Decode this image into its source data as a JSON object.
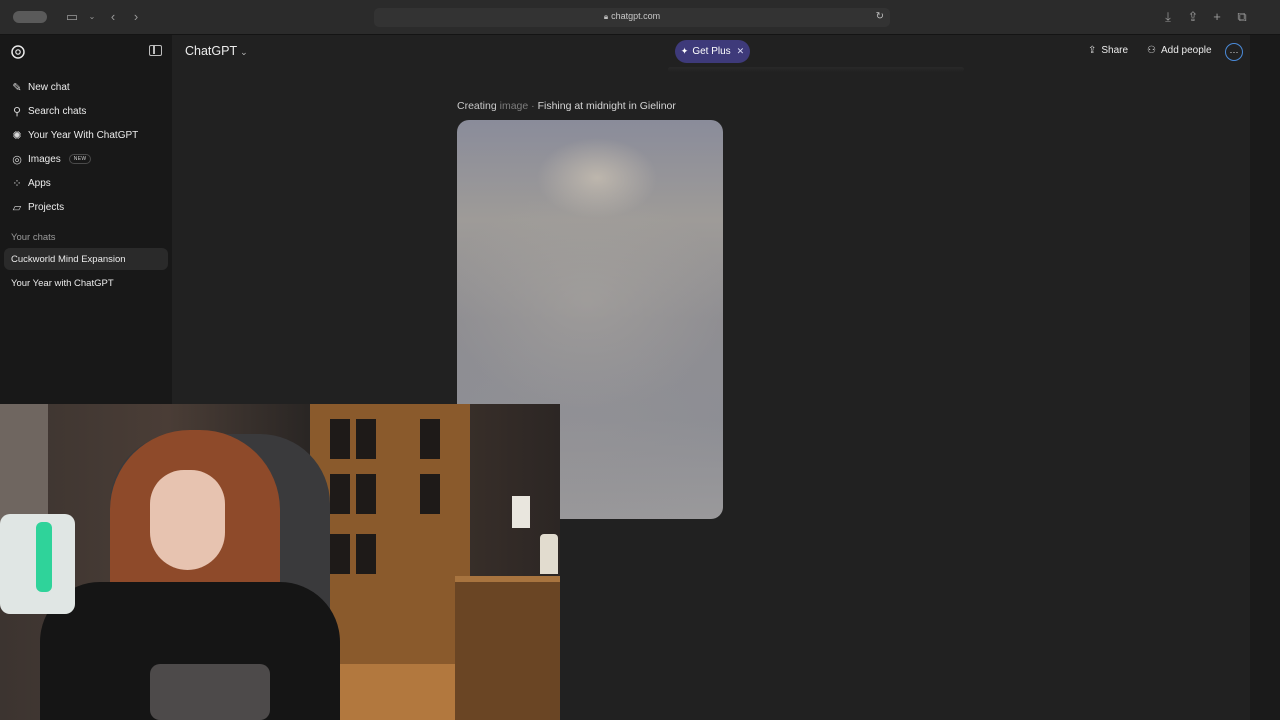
{
  "browser": {
    "url": "chatgpt.com"
  },
  "sidebar": {
    "nav": [
      {
        "label": "New chat",
        "icon": "new-chat-icon"
      },
      {
        "label": "Search chats",
        "icon": "search-icon"
      },
      {
        "label": "Your Year With ChatGPT",
        "icon": "year-icon"
      },
      {
        "label": "Images",
        "icon": "images-icon",
        "badge": "NEW"
      },
      {
        "label": "Apps",
        "icon": "apps-icon"
      },
      {
        "label": "Projects",
        "icon": "folder-icon"
      }
    ],
    "section_label": "Your chats",
    "chats": [
      {
        "label": "Cuckworld Mind Expansion",
        "active": true
      },
      {
        "label": "Your Year with ChatGPT",
        "active": false
      }
    ]
  },
  "header": {
    "model": "ChatGPT",
    "get_plus": "Get Plus",
    "share": "Share",
    "add_people": "Add people"
  },
  "main": {
    "status_verb": "Creating",
    "status_dim": "image",
    "status_separator": "·",
    "status_title": "Fishing at midnight in Gielinor"
  },
  "colors": {
    "background": "#212121",
    "sidebar": "#181818",
    "get_plus_bg": "#3e3a7a",
    "accent_ring": "#4a8ad8"
  }
}
